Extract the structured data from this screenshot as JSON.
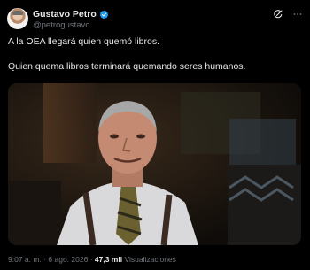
{
  "author": {
    "name": "Gustavo Petro",
    "handle": "@petrogustavo",
    "verified": true
  },
  "tweet": {
    "lines": [
      "A la OEA llegará quien quemó libros.",
      "Quien quema libros terminará quemando seres humanos."
    ]
  },
  "meta": {
    "time": "9:07 a. m.",
    "separator": "·",
    "date": "6 ago. 2026",
    "views_count": "47,3 mil",
    "views_label": "Visualizaciones"
  },
  "icons": {
    "verified": "verified-badge-icon",
    "grok": "grok-icon",
    "more": "more-options-icon"
  },
  "colors": {
    "background": "#000000",
    "text": "#e7e9ea",
    "secondary": "#71767b",
    "verified": "#1d9bf0"
  }
}
